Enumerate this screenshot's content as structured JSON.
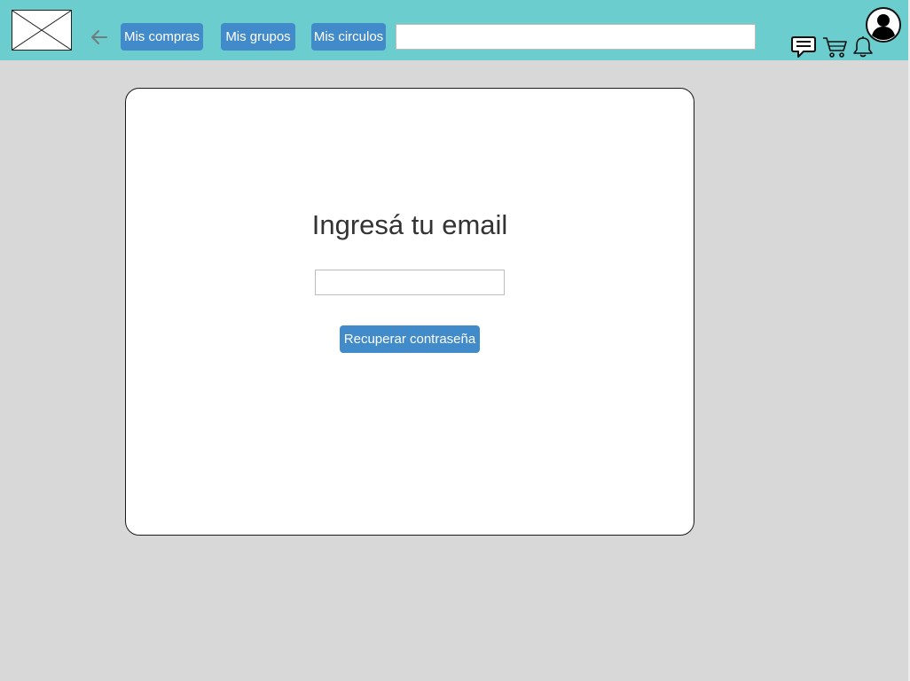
{
  "header": {
    "logo_icon": "image-placeholder-icon",
    "back_icon": "arrow-left-icon",
    "nav": {
      "compras": "Mis compras",
      "grupos": "Mis grupos",
      "circulos": "Mis circulos"
    },
    "search": {
      "value": "",
      "placeholder": ""
    },
    "icons": [
      "chat-icon",
      "cart-icon",
      "bell-icon",
      "avatar-icon"
    ]
  },
  "recovery": {
    "title": "Ingresá tu email",
    "email_value": "",
    "email_placeholder": "",
    "submit_label": "Recuperar contraseña"
  },
  "colors": {
    "header_bg": "#6bcdcd",
    "page_bg": "#d8d8d8",
    "button_bg": "#428bca",
    "button_text": "#ffffff"
  }
}
